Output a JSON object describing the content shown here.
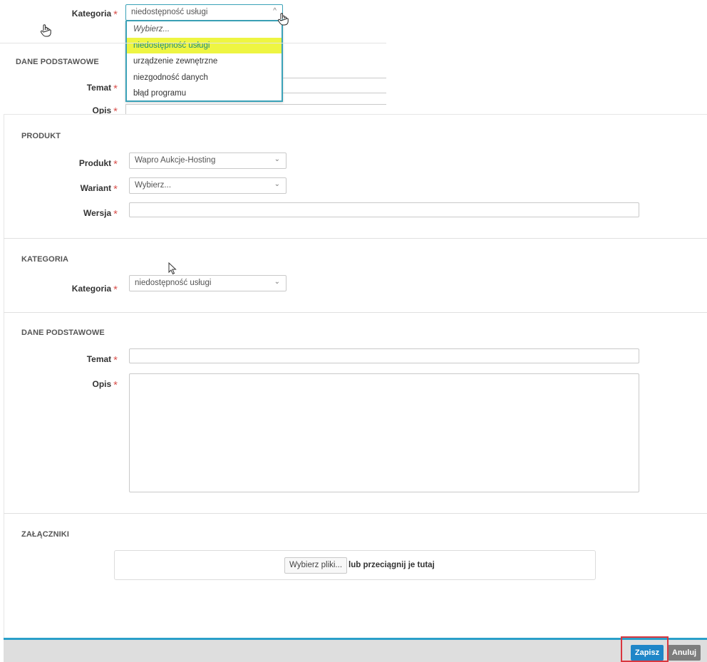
{
  "overlay": {
    "kategoria_label": "Kategoria",
    "kategoria_value": "niedostępność usługi",
    "dropdown_options": [
      "Wybierz...",
      "niedostępność usługi",
      "urządzenie zewnętrzne",
      "niezgodność danych",
      "błąd programu"
    ],
    "highlighted_option": "niedostępność usługi",
    "section_title": "DANE PODSTAWOWE",
    "temat_label": "Temat",
    "opis_label": "Opis"
  },
  "produkt_section": {
    "title": "PRODUKT",
    "produkt_label": "Produkt",
    "produkt_value": "Wapro Aukcje-Hosting",
    "wariant_label": "Wariant",
    "wariant_value": "Wybierz...",
    "wersja_label": "Wersja",
    "wersja_value": ""
  },
  "kategoria_section": {
    "title": "KATEGORIA",
    "kategoria_label": "Kategoria",
    "kategoria_value": "niedostępność usługi"
  },
  "dane_section": {
    "title": "DANE PODSTAWOWE",
    "temat_label": "Temat",
    "temat_value": "",
    "opis_label": "Opis",
    "opis_value": ""
  },
  "zalaczniki_section": {
    "title": "ZAŁĄCZNIKI",
    "pick_button": "Wybierz pliki...",
    "drag_text": "lub przeciągnij je tutaj"
  },
  "footer": {
    "save_label": "Zapisz",
    "cancel_label": "Anuluj"
  },
  "required_marker": "*",
  "colors": {
    "accent": "#2a9fc9",
    "save_button": "#1f86c8",
    "cancel_button": "#7d7d7d",
    "required": "#d9534f",
    "highlight_option": "#eef542",
    "annotation_box": "#d9363e"
  }
}
